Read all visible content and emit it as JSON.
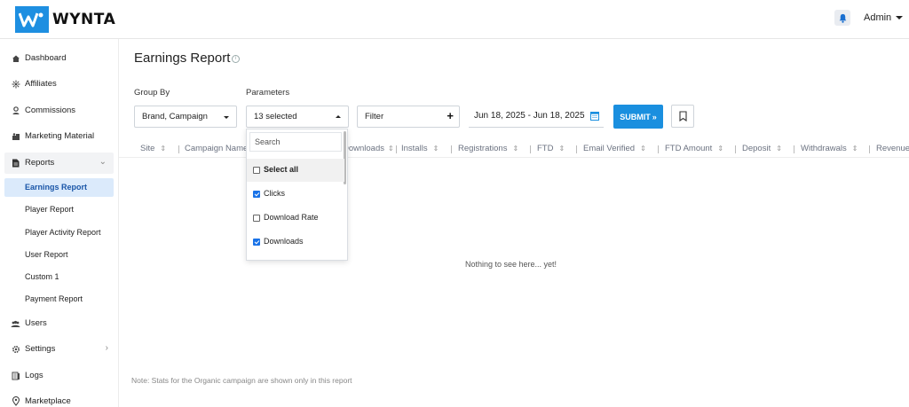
{
  "brand": {
    "name": "WYNTA",
    "color": "#1e8fe1"
  },
  "header": {
    "user": "Admin"
  },
  "sidebar": {
    "items": [
      {
        "label": "Dashboard",
        "icon": "home-icon"
      },
      {
        "label": "Affiliates",
        "icon": "network-icon"
      },
      {
        "label": "Commissions",
        "icon": "coins-icon"
      },
      {
        "label": "Marketing Material",
        "icon": "megaphone-icon"
      },
      {
        "label": "Reports",
        "icon": "file-icon"
      },
      {
        "label": "Users",
        "icon": "users-icon"
      },
      {
        "label": "Settings",
        "icon": "gear-icon"
      },
      {
        "label": "Logs",
        "icon": "logs-icon"
      },
      {
        "label": "Marketplace",
        "icon": "location-icon"
      }
    ],
    "report_subitems": [
      {
        "label": "Earnings Report",
        "active": true
      },
      {
        "label": "Player Report"
      },
      {
        "label": "Player Activity Report"
      },
      {
        "label": "User Report"
      },
      {
        "label": "Custom 1"
      },
      {
        "label": "Payment Report"
      }
    ]
  },
  "main": {
    "title": "Earnings Report",
    "group_by_label": "Group By",
    "group_by_value": "Brand, Campaign",
    "parameters_label": "Parameters",
    "parameters_value": "13 selected",
    "filter_label": "Filter",
    "date_range": "Jun 18, 2025 - Jun 18, 2025",
    "submit_label": "SUBMIT",
    "columns": [
      "Site",
      "Campaign Name",
      "Downloads",
      "Installs",
      "Registrations",
      "FTD",
      "Email Verified",
      "FTD Amount",
      "Deposit",
      "Withdrawals",
      "Revenue"
    ],
    "empty_text": "Nothing to see here... yet!",
    "note": "Note: Stats for the Organic campaign are shown only in this report"
  },
  "dropdown": {
    "search_placeholder": "Search",
    "options": [
      {
        "label": "Select all",
        "checked": false
      },
      {
        "label": "Clicks",
        "checked": true
      },
      {
        "label": "Download Rate",
        "checked": false
      },
      {
        "label": "Downloads",
        "checked": true
      }
    ]
  },
  "colors": {
    "accent": "#1a8fdf",
    "active_bg": "#dbeafb"
  }
}
